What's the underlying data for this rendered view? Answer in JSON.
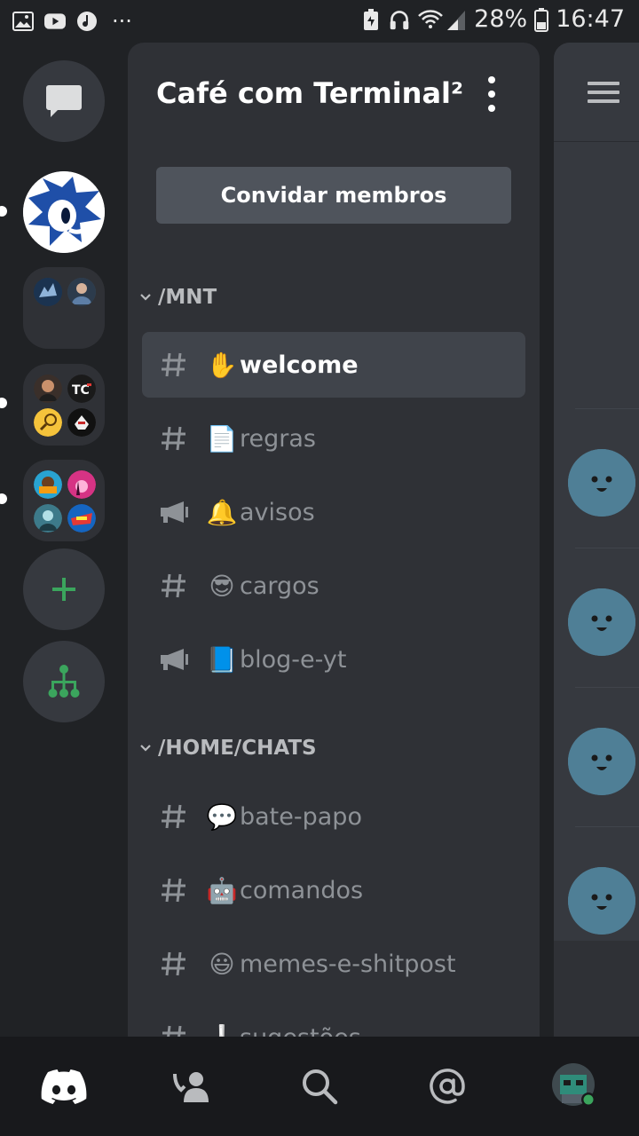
{
  "status_bar": {
    "battery_percent": "28%",
    "time": "16:47",
    "more_dots": "···"
  },
  "server_title": "Café com Terminal²",
  "invite_button": "Convidar membros",
  "categories": [
    {
      "name": "/MNT",
      "channels": [
        {
          "emoji": "✋",
          "name": "welcome",
          "type": "text",
          "active": true
        },
        {
          "emoji": "📄",
          "name": "regras",
          "type": "text",
          "active": false
        },
        {
          "emoji": "🔔",
          "name": "avisos",
          "type": "announcement",
          "active": false
        },
        {
          "emoji": "😎",
          "name": "cargos",
          "type": "text",
          "active": false
        },
        {
          "emoji": "📘",
          "name": "blog-e-yt",
          "type": "announcement",
          "active": false
        }
      ]
    },
    {
      "name": "/HOME/CHATS",
      "channels": [
        {
          "emoji": "💬",
          "name": "bate-papo",
          "type": "text",
          "active": false
        },
        {
          "emoji": "🤖",
          "name": "comandos",
          "type": "text",
          "active": false
        },
        {
          "emoji": "😃",
          "name": "memes-e-shitpost",
          "type": "text",
          "active": false
        },
        {
          "emoji": "❕",
          "name": "sugestões",
          "type": "text",
          "active": false
        }
      ]
    }
  ],
  "colors": {
    "background": "#202225",
    "panel": "#2f3136",
    "active_channel": "#40444b",
    "accent_green": "#3ba55d",
    "blurple": "#5865f2"
  },
  "icons": {
    "rail": [
      "direct-messages-icon",
      "add-server-icon",
      "explore-servers-icon"
    ],
    "bottom_nav": [
      "discord-home-icon",
      "friends-icon",
      "search-icon",
      "mentions-icon",
      "profile-avatar"
    ]
  }
}
